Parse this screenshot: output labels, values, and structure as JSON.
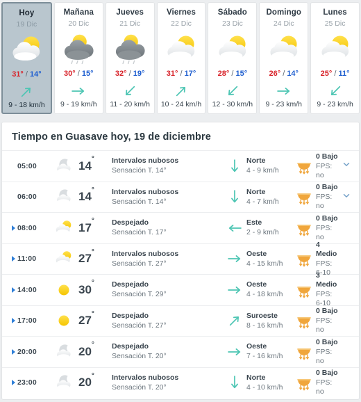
{
  "daily": {
    "days": [
      {
        "name": "Hoy",
        "date": "19 Dic",
        "icon": "sun-behind-white-cloud",
        "max": "31°",
        "sep": "/",
        "min": "14°",
        "wind_arrow": "arrow-up-right",
        "wind": "9 - 18 km/h",
        "today": true
      },
      {
        "name": "Mañana",
        "date": "20 Dic",
        "icon": "sun-behind-dark-cloud",
        "max": "30°",
        "sep": "/",
        "min": "15°",
        "wind_arrow": "arrow-right",
        "wind": "9 - 19 km/h",
        "today": false
      },
      {
        "name": "Jueves",
        "date": "21 Dic",
        "icon": "sun-behind-dark-cloud",
        "max": "32°",
        "sep": "/",
        "min": "19°",
        "wind_arrow": "arrow-down-left",
        "wind": "11 - 20 km/h",
        "today": false
      },
      {
        "name": "Viernes",
        "date": "22 Dic",
        "icon": "sun-behind-white-cloud",
        "max": "31°",
        "sep": "/",
        "min": "17°",
        "wind_arrow": "arrow-up-right",
        "wind": "10 - 24 km/h",
        "today": false
      },
      {
        "name": "Sábado",
        "date": "23 Dic",
        "icon": "sun-behind-white-cloud",
        "max": "28°",
        "sep": "/",
        "min": "15°",
        "wind_arrow": "arrow-down-left",
        "wind": "12 - 30 km/h",
        "today": false
      },
      {
        "name": "Domingo",
        "date": "24 Dic",
        "icon": "sun-behind-white-cloud",
        "max": "26°",
        "sep": "/",
        "min": "14°",
        "wind_arrow": "arrow-right",
        "wind": "9 - 23 km/h",
        "today": false
      },
      {
        "name": "Lunes",
        "date": "25 Dic",
        "icon": "sun-behind-white-cloud",
        "max": "25°",
        "sep": "/",
        "min": "11°",
        "wind_arrow": "arrow-down-left",
        "wind": "9 - 23 km/h",
        "today": false
      }
    ]
  },
  "hourly": {
    "title": "Tiempo en Guasave hoy, 19 de diciembre",
    "rows": [
      {
        "expander": false,
        "time": "05:00",
        "icon": "moon-behind-cloud",
        "temp": "14",
        "deg": "°",
        "desc": "Intervalos nubosos",
        "feels": "Sensación T. 14°",
        "wind_arrow": "arrow-down",
        "wind_dir": "Norte",
        "wind_speed": "4 - 9 km/h",
        "uv_icon": "uv-sun-rays",
        "uv": "0 Bajo",
        "fps": "FPS: no",
        "chevron": true
      },
      {
        "expander": false,
        "time": "06:00",
        "icon": "moon-behind-cloud",
        "temp": "14",
        "deg": "°",
        "desc": "Intervalos nubosos",
        "feels": "Sensación T. 14°",
        "wind_arrow": "arrow-down",
        "wind_dir": "Norte",
        "wind_speed": "4 - 7 km/h",
        "uv_icon": "uv-sun-rays",
        "uv": "0 Bajo",
        "fps": "FPS: no",
        "chevron": true
      },
      {
        "expander": true,
        "time": "08:00",
        "icon": "sun-behind-cloud",
        "temp": "17",
        "deg": "°",
        "desc": "Despejado",
        "feels": "Sensación T. 17°",
        "wind_arrow": "arrow-left",
        "wind_dir": "Este",
        "wind_speed": "2 - 9 km/h",
        "uv_icon": "uv-sun-rays",
        "uv": "0 Bajo",
        "fps": "FPS: no",
        "chevron": false
      },
      {
        "expander": true,
        "time": "11:00",
        "icon": "sun-behind-cloud",
        "temp": "27",
        "deg": "°",
        "desc": "Intervalos nubosos",
        "feels": "Sensación T. 27°",
        "wind_arrow": "arrow-right",
        "wind_dir": "Oeste",
        "wind_speed": "4 - 15 km/h",
        "uv_icon": "uv-sun-rays",
        "uv": "4 Medio",
        "fps": "FPS: 6-10",
        "chevron": false
      },
      {
        "expander": true,
        "time": "14:00",
        "icon": "sun",
        "temp": "30",
        "deg": "°",
        "desc": "Despejado",
        "feels": "Sensación T. 29°",
        "wind_arrow": "arrow-right",
        "wind_dir": "Oeste",
        "wind_speed": "4 - 18 km/h",
        "uv_icon": "uv-sun-rays",
        "uv": "3 Medio",
        "fps": "FPS: 6-10",
        "chevron": false
      },
      {
        "expander": true,
        "time": "17:00",
        "icon": "sun",
        "temp": "27",
        "deg": "°",
        "desc": "Despejado",
        "feels": "Sensación T. 27°",
        "wind_arrow": "arrow-up-right",
        "wind_dir": "Suroeste",
        "wind_speed": "8 - 16 km/h",
        "uv_icon": "uv-sun-rays",
        "uv": "0 Bajo",
        "fps": "FPS: no",
        "chevron": false
      },
      {
        "expander": true,
        "time": "20:00",
        "icon": "moon-behind-cloud",
        "temp": "20",
        "deg": "°",
        "desc": "Despejado",
        "feels": "Sensación T. 20°",
        "wind_arrow": "arrow-right",
        "wind_dir": "Oeste",
        "wind_speed": "7 - 16 km/h",
        "uv_icon": "uv-sun-rays",
        "uv": "0 Bajo",
        "fps": "FPS: no",
        "chevron": false
      },
      {
        "expander": true,
        "time": "23:00",
        "icon": "moon-behind-cloud",
        "temp": "20",
        "deg": "°",
        "desc": "Intervalos nubosos",
        "feels": "Sensación T. 20°",
        "wind_arrow": "arrow-down",
        "wind_dir": "Norte",
        "wind_speed": "4 - 10 km/h",
        "uv_icon": "uv-sun-rays",
        "uv": "0 Bajo",
        "fps": "FPS: no",
        "chevron": false
      }
    ]
  },
  "colors": {
    "temp_max": "#d8232a",
    "temp_min": "#1f5fd0",
    "wind_arrow": "#4cc5b3",
    "uv_icon": "#f0a63c",
    "today_card": "#b9c6ce",
    "page_bg": "#eceef0"
  }
}
